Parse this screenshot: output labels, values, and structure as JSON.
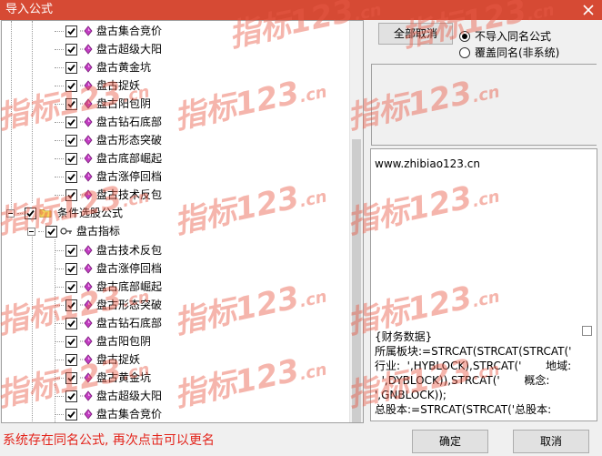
{
  "window": {
    "title": "导入公式",
    "close_icon": "close-icon"
  },
  "tree": {
    "group1_items": [
      "盘古集合竞价",
      "盘古超级大阳",
      "盘古黄金坑",
      "盘古捉妖",
      "盘古阳包阴",
      "盘古钻石底部",
      "盘古形态突破",
      "盘古底部崛起",
      "盘古涨停回档",
      "盘古技术反包"
    ],
    "category_label": "条件选股公式",
    "subgroup_label": "盘古指标",
    "group2_items": [
      "盘古技术反包",
      "盘古涨停回档",
      "盘古底部崛起",
      "盘古形态突破",
      "盘古钻石底部",
      "盘古阳包阴",
      "盘古捉妖",
      "盘古黄金坑",
      "盘古超级大阳",
      "盘古集合竞价"
    ]
  },
  "options": {
    "cancel_all_label": "全部取消",
    "radio_no_import": "不导入同名公式",
    "radio_overwrite": "覆盖同名(非系统)",
    "selected": "不导入同名公式"
  },
  "description": {
    "url": "www.zhibiao123.cn",
    "code_lines": [
      "{财务数据}",
      "所属板块:=STRCAT(STRCAT(STRCAT('",
      "行业:  ',HYBLOCK),STRCAT('       地域:",
      "  ',DYBLOCK)),STRCAT('       概念:",
      "',GNBLOCK));",
      "总股本:=STRCAT(STRCAT('总股本:"
    ]
  },
  "footer": {
    "status_text": "系统存在同名公式, 再次点击可以更名",
    "ok_label": "确定",
    "cancel_label": "取消"
  },
  "watermark": {
    "text": "指标123",
    "suffix": ".cn"
  },
  "colors": {
    "title_bar": "#d64a34",
    "status_text": "#e3241b",
    "watermark": "#e85a46"
  }
}
